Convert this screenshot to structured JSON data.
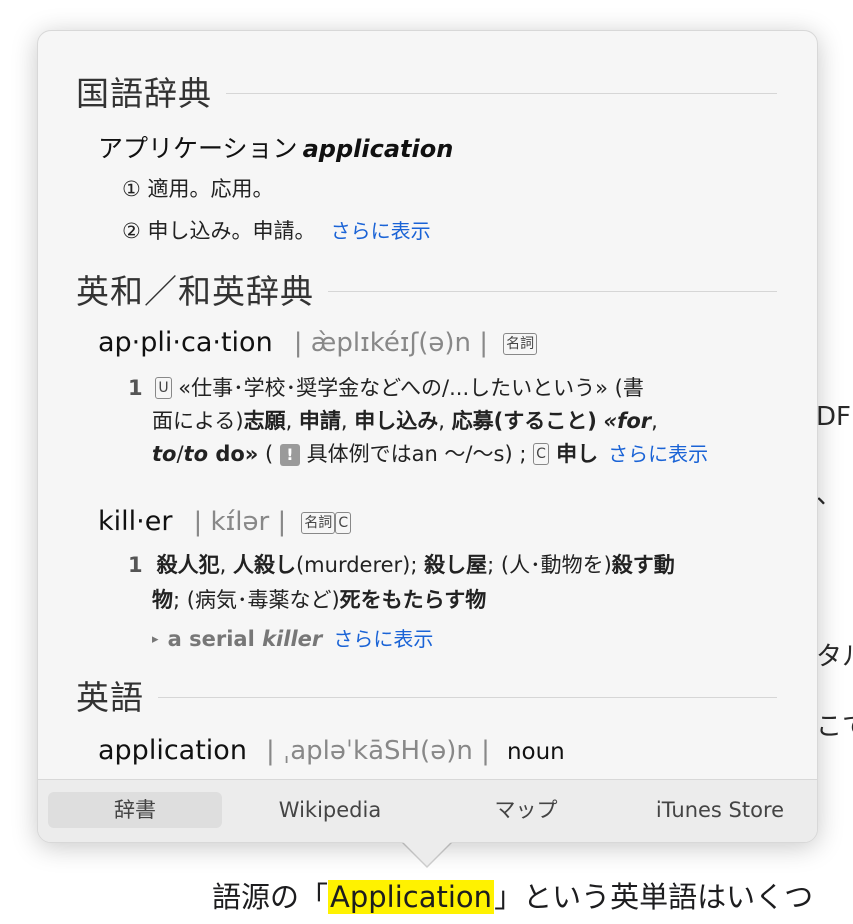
{
  "background": {
    "fragments": [
      "DF",
      "、",
      "タル",
      "こて"
    ],
    "line_before": "語源の「",
    "line_highlight": "Application",
    "line_after": "」という英単語はいくつ"
  },
  "sections": {
    "kokugo": {
      "title": "国語辞典",
      "headword_jp": "アプリケーション",
      "headword_en": "application",
      "sense1": "① 適用。応用。",
      "sense2": "② 申し込み。申請。",
      "more": "さらに表示"
    },
    "eiwa": {
      "title": "英和／和英辞典",
      "entry1": {
        "headword": "ap·pli·ca·tion",
        "pron": "| æ̀plɪkéɪʃ(ə)n |",
        "pos": "名詞",
        "num": "1",
        "u": "U",
        "l1": "«仕事･学校･奨学金などへの/...したいという» (書",
        "l2a": "面による)",
        "l2b": "志願",
        "l2c": ", ",
        "l2d": "申請",
        "l2e": ", ",
        "l2f": "申し込み",
        "l2g": ", ",
        "l2h": "応募(すること)",
        "l2i": " ",
        "l2j": "«for",
        "l2k": ",",
        "l3a": "to",
        "l3b": "/",
        "l3c": "to",
        "l3d": " do»",
        "l3e": " ( ",
        "warn": "!",
        "l3f": " 具体例ではan ～/～s) ; ",
        "c": "C",
        "l3g": " 申し",
        "more": "さらに表示"
      },
      "entry2": {
        "headword": "kill·er",
        "pron": "| kɪ́lər |",
        "pos": "名詞",
        "c": "C",
        "num": "1",
        "l1a": "殺人犯",
        "l1b": ", ",
        "l1c": "人殺し",
        "l1d": "(murderer); ",
        "l1e": "殺し屋",
        "l1f": "; (人･動物を)",
        "l1g": "殺す動",
        "l2a": "物",
        "l2b": "; (病気･毒薬など)",
        "l2c": "死をもたらす物",
        "ex_a": "a serial ",
        "ex_b": "killer",
        "more": "さらに表示"
      }
    },
    "eigo": {
      "title": "英語",
      "headword": "application",
      "pron": "| ˌapləˈkāSH(ə)n |",
      "pos": "noun"
    }
  },
  "tabs": {
    "dict": "辞書",
    "wiki": "Wikipedia",
    "map": "マップ",
    "itunes": "iTunes Store"
  }
}
